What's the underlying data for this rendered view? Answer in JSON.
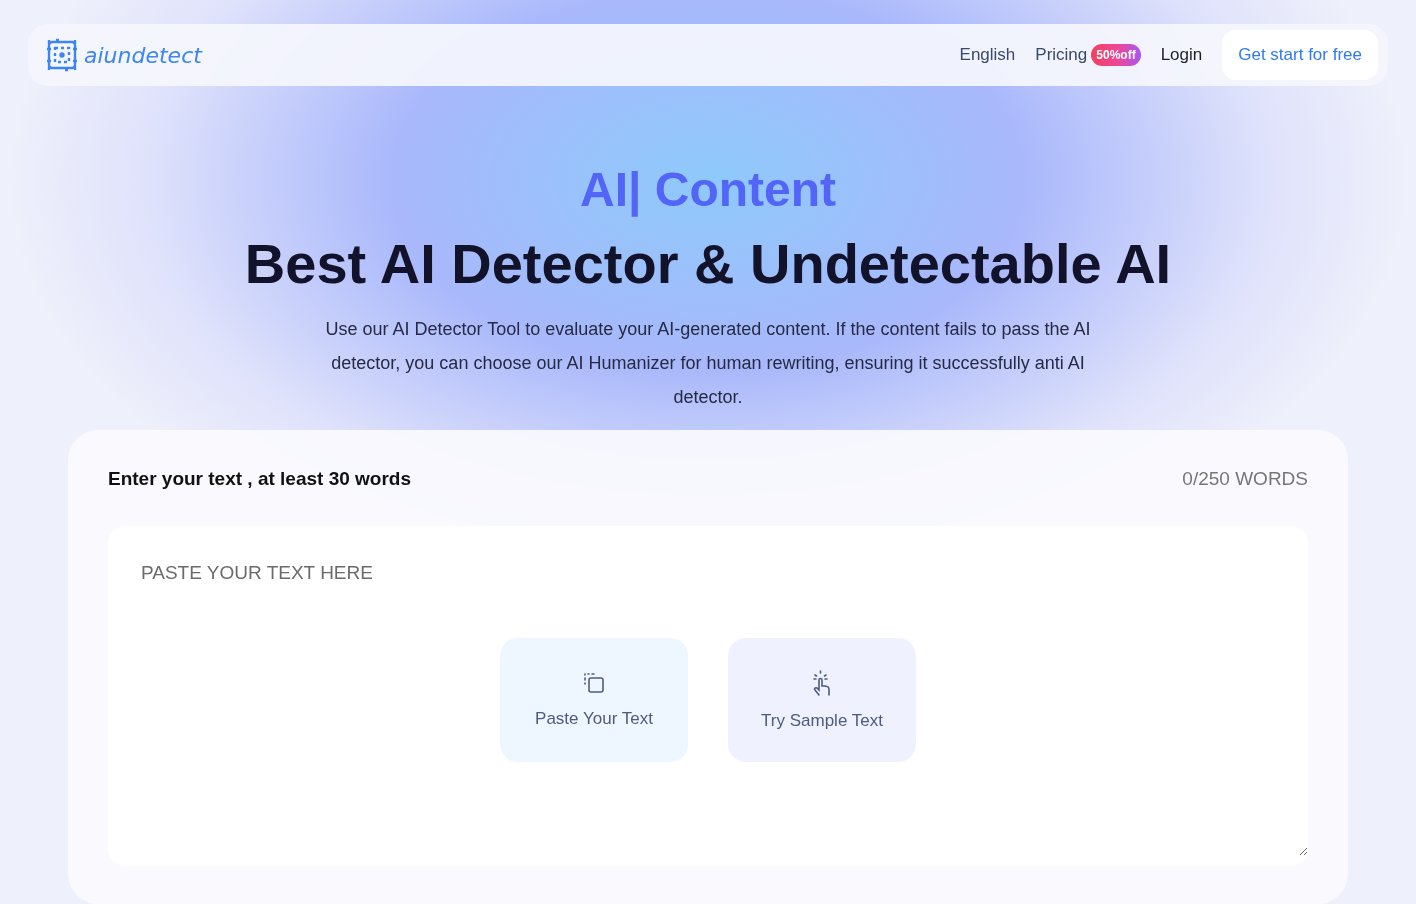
{
  "nav": {
    "logo": "aiundetect",
    "links": [
      {
        "label": "English",
        "kind": "plain"
      },
      {
        "label": "Pricing",
        "kind": "badge",
        "badge": "50%off"
      },
      {
        "label": "Login",
        "kind": "dark"
      }
    ],
    "cta": "Get start for free"
  },
  "hero": {
    "typed": "AI| Content",
    "title": "Best AI Detector & Undetectable AI",
    "description": "Use our AI Detector Tool to evaluate your AI-generated content. If the content fails to pass the AI detector, you can choose our AI Humanizer for human rewriting, ensuring it successfully anti AI detector."
  },
  "editor": {
    "label": "Enter your text , at least 30 words",
    "count": "0/250 WORDS",
    "placeholder": "PASTE YOUR TEXT HERE",
    "actions": [
      {
        "kind": "paste",
        "label": "Paste Your Text"
      },
      {
        "kind": "sample",
        "label": "Try Sample Text"
      }
    ]
  }
}
